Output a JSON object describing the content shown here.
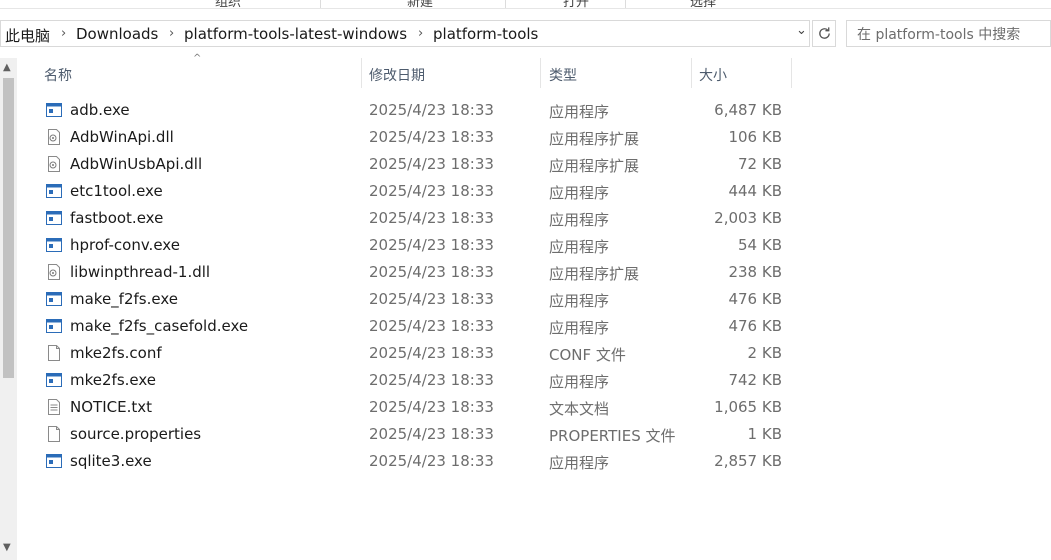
{
  "ribbon": {
    "labels": [
      "组织",
      "新建",
      "打开",
      "选择"
    ]
  },
  "address": {
    "crumbs": [
      "此电脑",
      "Downloads",
      "platform-tools-latest-windows",
      "platform-tools"
    ],
    "separator": "›",
    "dropdown": "⌄"
  },
  "search": {
    "placeholder": "在 platform-tools 中搜索"
  },
  "columns": {
    "name": "名称",
    "date": "修改日期",
    "type": "类型",
    "size": "大小"
  },
  "files": [
    {
      "name": "adb.exe",
      "date": "2025/4/23 18:33",
      "type": "应用程序",
      "size": "6,487 KB",
      "icon": "exe-icon"
    },
    {
      "name": "AdbWinApi.dll",
      "date": "2025/4/23 18:33",
      "type": "应用程序扩展",
      "size": "106 KB",
      "icon": "dll-icon"
    },
    {
      "name": "AdbWinUsbApi.dll",
      "date": "2025/4/23 18:33",
      "type": "应用程序扩展",
      "size": "72 KB",
      "icon": "dll-icon"
    },
    {
      "name": "etc1tool.exe",
      "date": "2025/4/23 18:33",
      "type": "应用程序",
      "size": "444 KB",
      "icon": "exe-icon"
    },
    {
      "name": "fastboot.exe",
      "date": "2025/4/23 18:33",
      "type": "应用程序",
      "size": "2,003 KB",
      "icon": "exe-icon"
    },
    {
      "name": "hprof-conv.exe",
      "date": "2025/4/23 18:33",
      "type": "应用程序",
      "size": "54 KB",
      "icon": "exe-icon"
    },
    {
      "name": "libwinpthread-1.dll",
      "date": "2025/4/23 18:33",
      "type": "应用程序扩展",
      "size": "238 KB",
      "icon": "dll-icon"
    },
    {
      "name": "make_f2fs.exe",
      "date": "2025/4/23 18:33",
      "type": "应用程序",
      "size": "476 KB",
      "icon": "exe-icon"
    },
    {
      "name": "make_f2fs_casefold.exe",
      "date": "2025/4/23 18:33",
      "type": "应用程序",
      "size": "476 KB",
      "icon": "exe-icon"
    },
    {
      "name": "mke2fs.conf",
      "date": "2025/4/23 18:33",
      "type": "CONF 文件",
      "size": "2 KB",
      "icon": "blank-file-icon"
    },
    {
      "name": "mke2fs.exe",
      "date": "2025/4/23 18:33",
      "type": "应用程序",
      "size": "742 KB",
      "icon": "exe-icon"
    },
    {
      "name": "NOTICE.txt",
      "date": "2025/4/23 18:33",
      "type": "文本文档",
      "size": "1,065 KB",
      "icon": "text-file-icon"
    },
    {
      "name": "source.properties",
      "date": "2025/4/23 18:33",
      "type": "PROPERTIES 文件",
      "size": "1 KB",
      "icon": "blank-file-icon"
    },
    {
      "name": "sqlite3.exe",
      "date": "2025/4/23 18:33",
      "type": "应用程序",
      "size": "2,857 KB",
      "icon": "exe-icon"
    }
  ]
}
